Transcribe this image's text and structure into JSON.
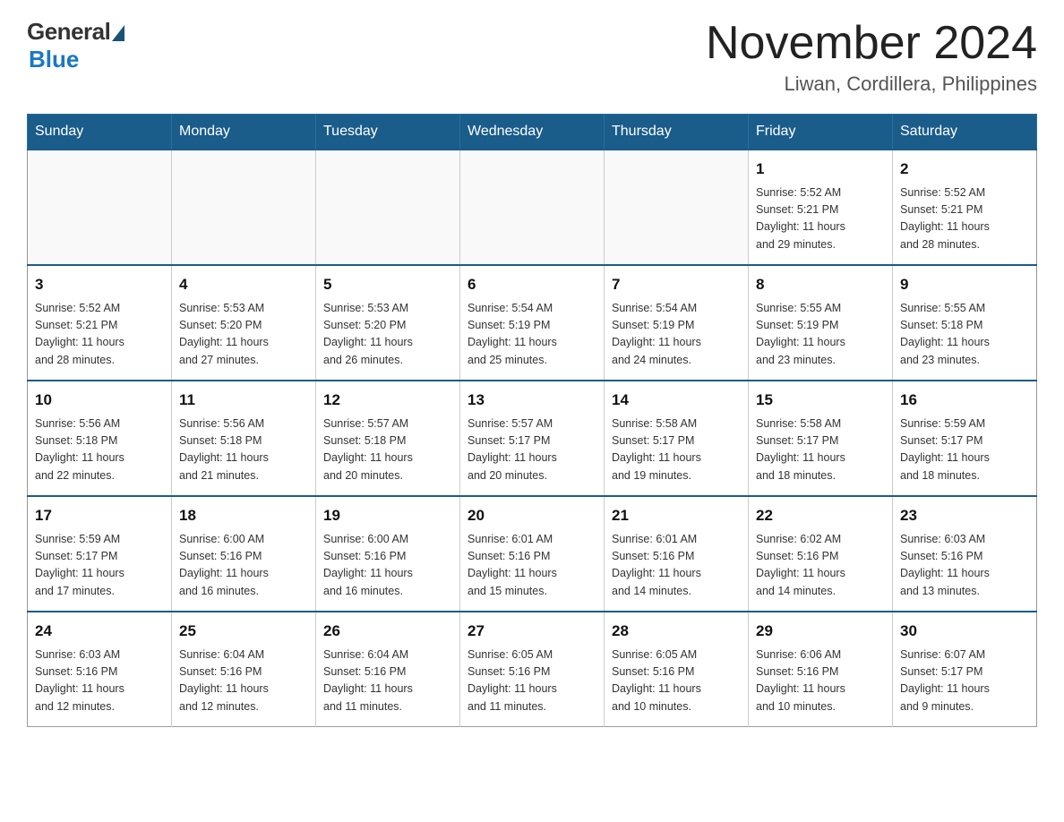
{
  "logo": {
    "general": "General",
    "blue": "Blue"
  },
  "title": "November 2024",
  "subtitle": "Liwan, Cordillera, Philippines",
  "days_of_week": [
    "Sunday",
    "Monday",
    "Tuesday",
    "Wednesday",
    "Thursday",
    "Friday",
    "Saturday"
  ],
  "weeks": [
    {
      "days": [
        {
          "number": "",
          "empty": true
        },
        {
          "number": "",
          "empty": true
        },
        {
          "number": "",
          "empty": true
        },
        {
          "number": "",
          "empty": true
        },
        {
          "number": "",
          "empty": true
        },
        {
          "number": "1",
          "sunrise": "5:52 AM",
          "sunset": "5:21 PM",
          "daylight": "11 hours and 29 minutes."
        },
        {
          "number": "2",
          "sunrise": "5:52 AM",
          "sunset": "5:21 PM",
          "daylight": "11 hours and 28 minutes."
        }
      ]
    },
    {
      "days": [
        {
          "number": "3",
          "sunrise": "5:52 AM",
          "sunset": "5:21 PM",
          "daylight": "11 hours and 28 minutes."
        },
        {
          "number": "4",
          "sunrise": "5:53 AM",
          "sunset": "5:20 PM",
          "daylight": "11 hours and 27 minutes."
        },
        {
          "number": "5",
          "sunrise": "5:53 AM",
          "sunset": "5:20 PM",
          "daylight": "11 hours and 26 minutes."
        },
        {
          "number": "6",
          "sunrise": "5:54 AM",
          "sunset": "5:19 PM",
          "daylight": "11 hours and 25 minutes."
        },
        {
          "number": "7",
          "sunrise": "5:54 AM",
          "sunset": "5:19 PM",
          "daylight": "11 hours and 24 minutes."
        },
        {
          "number": "8",
          "sunrise": "5:55 AM",
          "sunset": "5:19 PM",
          "daylight": "11 hours and 23 minutes."
        },
        {
          "number": "9",
          "sunrise": "5:55 AM",
          "sunset": "5:18 PM",
          "daylight": "11 hours and 23 minutes."
        }
      ]
    },
    {
      "days": [
        {
          "number": "10",
          "sunrise": "5:56 AM",
          "sunset": "5:18 PM",
          "daylight": "11 hours and 22 minutes."
        },
        {
          "number": "11",
          "sunrise": "5:56 AM",
          "sunset": "5:18 PM",
          "daylight": "11 hours and 21 minutes."
        },
        {
          "number": "12",
          "sunrise": "5:57 AM",
          "sunset": "5:18 PM",
          "daylight": "11 hours and 20 minutes."
        },
        {
          "number": "13",
          "sunrise": "5:57 AM",
          "sunset": "5:17 PM",
          "daylight": "11 hours and 20 minutes."
        },
        {
          "number": "14",
          "sunrise": "5:58 AM",
          "sunset": "5:17 PM",
          "daylight": "11 hours and 19 minutes."
        },
        {
          "number": "15",
          "sunrise": "5:58 AM",
          "sunset": "5:17 PM",
          "daylight": "11 hours and 18 minutes."
        },
        {
          "number": "16",
          "sunrise": "5:59 AM",
          "sunset": "5:17 PM",
          "daylight": "11 hours and 18 minutes."
        }
      ]
    },
    {
      "days": [
        {
          "number": "17",
          "sunrise": "5:59 AM",
          "sunset": "5:17 PM",
          "daylight": "11 hours and 17 minutes."
        },
        {
          "number": "18",
          "sunrise": "6:00 AM",
          "sunset": "5:16 PM",
          "daylight": "11 hours and 16 minutes."
        },
        {
          "number": "19",
          "sunrise": "6:00 AM",
          "sunset": "5:16 PM",
          "daylight": "11 hours and 16 minutes."
        },
        {
          "number": "20",
          "sunrise": "6:01 AM",
          "sunset": "5:16 PM",
          "daylight": "11 hours and 15 minutes."
        },
        {
          "number": "21",
          "sunrise": "6:01 AM",
          "sunset": "5:16 PM",
          "daylight": "11 hours and 14 minutes."
        },
        {
          "number": "22",
          "sunrise": "6:02 AM",
          "sunset": "5:16 PM",
          "daylight": "11 hours and 14 minutes."
        },
        {
          "number": "23",
          "sunrise": "6:03 AM",
          "sunset": "5:16 PM",
          "daylight": "11 hours and 13 minutes."
        }
      ]
    },
    {
      "days": [
        {
          "number": "24",
          "sunrise": "6:03 AM",
          "sunset": "5:16 PM",
          "daylight": "11 hours and 12 minutes."
        },
        {
          "number": "25",
          "sunrise": "6:04 AM",
          "sunset": "5:16 PM",
          "daylight": "11 hours and 12 minutes."
        },
        {
          "number": "26",
          "sunrise": "6:04 AM",
          "sunset": "5:16 PM",
          "daylight": "11 hours and 11 minutes."
        },
        {
          "number": "27",
          "sunrise": "6:05 AM",
          "sunset": "5:16 PM",
          "daylight": "11 hours and 11 minutes."
        },
        {
          "number": "28",
          "sunrise": "6:05 AM",
          "sunset": "5:16 PM",
          "daylight": "11 hours and 10 minutes."
        },
        {
          "number": "29",
          "sunrise": "6:06 AM",
          "sunset": "5:16 PM",
          "daylight": "11 hours and 10 minutes."
        },
        {
          "number": "30",
          "sunrise": "6:07 AM",
          "sunset": "5:17 PM",
          "daylight": "11 hours and 9 minutes."
        }
      ]
    }
  ],
  "labels": {
    "sunrise": "Sunrise:",
    "sunset": "Sunset:",
    "daylight": "Daylight:"
  }
}
